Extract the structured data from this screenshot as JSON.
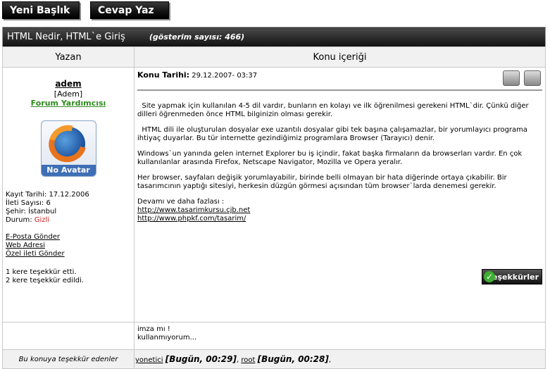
{
  "toolbar": {
    "new_topic": "Yeni Başlık",
    "reply": "Cevap Yaz"
  },
  "topic": {
    "title": "HTML Nedir, HTML`e Giriş",
    "views": "(gösterim sayısı: 466)"
  },
  "columns": {
    "author": "Yazan",
    "content": "Konu içeriği"
  },
  "author": {
    "username": "adem",
    "realname": "[Adem]",
    "role": "Forum Yardımcısı",
    "avatar_label": "No Avatar",
    "join": "Kayıt Tarihi: 17.12.2006",
    "posts": "İleti Sayısı: 6",
    "city": "Şehir: İstanbul",
    "status_label": "Durum: ",
    "status": "Gizli",
    "links": [
      "E-Posta Gönder",
      "Web Adresi",
      "Özel ileti Gönder"
    ],
    "thanks_given": "1 kere teşekkür etti.",
    "thanks_received": "2 kere teşekkür edildi."
  },
  "post": {
    "date_label": "Konu Tarihi:",
    "date": "29.12.2007- 03:37",
    "p1": "Site yapmak için kullanılan 4-5 dil vardır, bunların en kolayı ve ilk öğrenilmesi gerekeni HTML`dir. Çünkü diğer dilleri öğrenmeden önce HTML bilginizin olması gerekir.",
    "p2": "HTML dili ile oluşturulan dosyalar exe uzantılı dosyalar gibi tek başına çalışamazlar, bir yorumlayıcı programa ihtiyaç duyarlar. Bu tür internette gezindiğimiz programlara Browser (Tarayıcı) denir.",
    "p3": "Windows`un yanında gelen internet Explorer bu iş içindir, fakat başka firmaların da browserları vardır. En çok kullanılanlar arasında Firefox, Netscape Navigator, Mozilla ve Opera yeralır.",
    "p4": "Her browser, sayfaları değişik yorumlayabilir, birinde belli olmayan bir hata diğerinde ortaya çıkabilir. Bir tasarımcının yaptığı sitesiyi, herkesin düzgün görmesi açısından tüm browser`larda denemesi gerekir.",
    "more": "Devamı ve daha fazlası :",
    "link1": "http://www.tasarimkursu.cjb.net",
    "link2": "http://www.phpkf.com/tasarim/",
    "thanks_button": "Teşekkürler",
    "signature1": "imza mı !",
    "signature2": "kullanmıyorum..."
  },
  "footer": {
    "label": "Bu konuya teşekkür edenler",
    "user1": "yonetici",
    "when1": "[Bugün, 00:29]",
    "user2": "root",
    "when2": "[Bugün, 00:28]"
  }
}
